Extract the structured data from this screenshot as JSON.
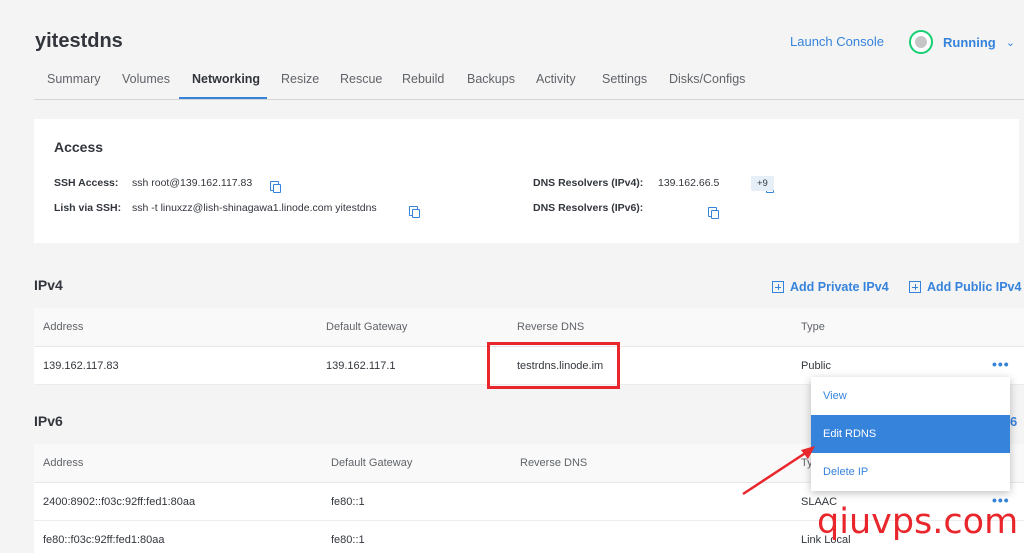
{
  "header": {
    "title": "yitestdns",
    "launch_console": "Launch Console",
    "status": "Running"
  },
  "tabs": [
    "Summary",
    "Volumes",
    "Networking",
    "Resize",
    "Rescue",
    "Rebuild",
    "Backups",
    "Activity",
    "Settings",
    "Disks/Configs"
  ],
  "access": {
    "heading": "Access",
    "ssh_label": "SSH Access:",
    "ssh_value": "ssh root@139.162.117.83",
    "lish_label": "Lish via SSH:",
    "lish_value": "ssh -t linuxzz@lish-shinagawa1.linode.com yitestdns",
    "dns4_label": "DNS Resolvers (IPv4):",
    "dns4_value": "139.162.66.5",
    "dns4_more": "+9",
    "dns6_label": "DNS Resolvers (IPv6):"
  },
  "ipv4": {
    "heading": "IPv4",
    "add_private": "Add Private IPv4",
    "add_public": "Add Public IPv4",
    "columns": [
      "Address",
      "Default Gateway",
      "Reverse DNS",
      "Type"
    ],
    "rows": [
      {
        "address": "139.162.117.83",
        "gateway": "139.162.117.1",
        "rdns": "testrdns.linode.im",
        "type": "Public"
      }
    ]
  },
  "ipv6": {
    "heading": "IPv6",
    "partial_action": "6",
    "columns": [
      "Address",
      "Default Gateway",
      "Reverse DNS",
      "Ty"
    ],
    "rows": [
      {
        "address": "2400:8902::f03c:92ff:fed1:80aa",
        "gateway": "fe80::1",
        "rdns": "",
        "type": "SLAAC"
      },
      {
        "address": "fe80::f03c:92ff:fed1:80aa",
        "gateway": "fe80::1",
        "rdns": "",
        "type": "Link Local"
      }
    ]
  },
  "action_menu": [
    "View",
    "Edit RDNS",
    "Delete IP"
  ],
  "watermark": "qiuvps.com",
  "icons": {
    "copy": "copy-icon",
    "plus": "plus-box-icon",
    "more": "more-dots-icon",
    "status": "status-ring-icon",
    "chevron": "chevron-down-icon"
  },
  "colors": {
    "accent": "#3683dc",
    "running": "#17cf73",
    "annotation": "#e8262b"
  }
}
